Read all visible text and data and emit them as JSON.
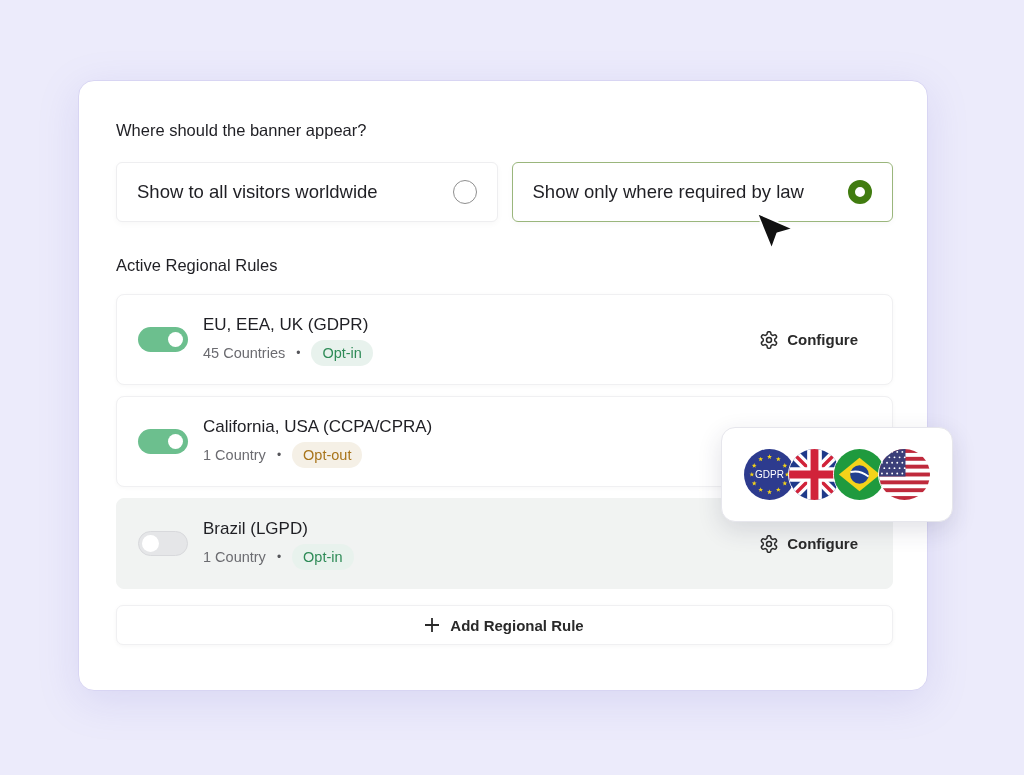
{
  "question": "Where should the banner appear?",
  "display_options": [
    {
      "label": "Show to all visitors worldwide",
      "selected": false
    },
    {
      "label": "Show only where required by law",
      "selected": true
    }
  ],
  "rules_heading": "Active Regional Rules",
  "rules": [
    {
      "name": "EU, EEA, UK (GDPR)",
      "enabled": true,
      "coverage": "45 Countries",
      "separator": "•",
      "consent": {
        "label": "Opt-in",
        "color": "#2e8b57"
      },
      "action": "Configure"
    },
    {
      "name": "California, USA (CCPA/CPRA)",
      "enabled": true,
      "coverage": "1 Country",
      "separator": "•",
      "consent": {
        "label": "Opt-out",
        "color": "#a8741a"
      }
    },
    {
      "name": "Brazil (LGPD)",
      "enabled": false,
      "coverage": "1 Country",
      "separator": "•",
      "consent": {
        "label": "Opt-in",
        "color": "#2e8b57"
      },
      "action": "Configure"
    }
  ],
  "add_rule": {
    "label": "Add Regional Rule"
  },
  "flags_popup": {
    "flags": [
      {
        "kind": "eu",
        "label": "GDPR"
      },
      {
        "kind": "uk"
      },
      {
        "kind": "brazil"
      },
      {
        "kind": "usa"
      }
    ]
  }
}
